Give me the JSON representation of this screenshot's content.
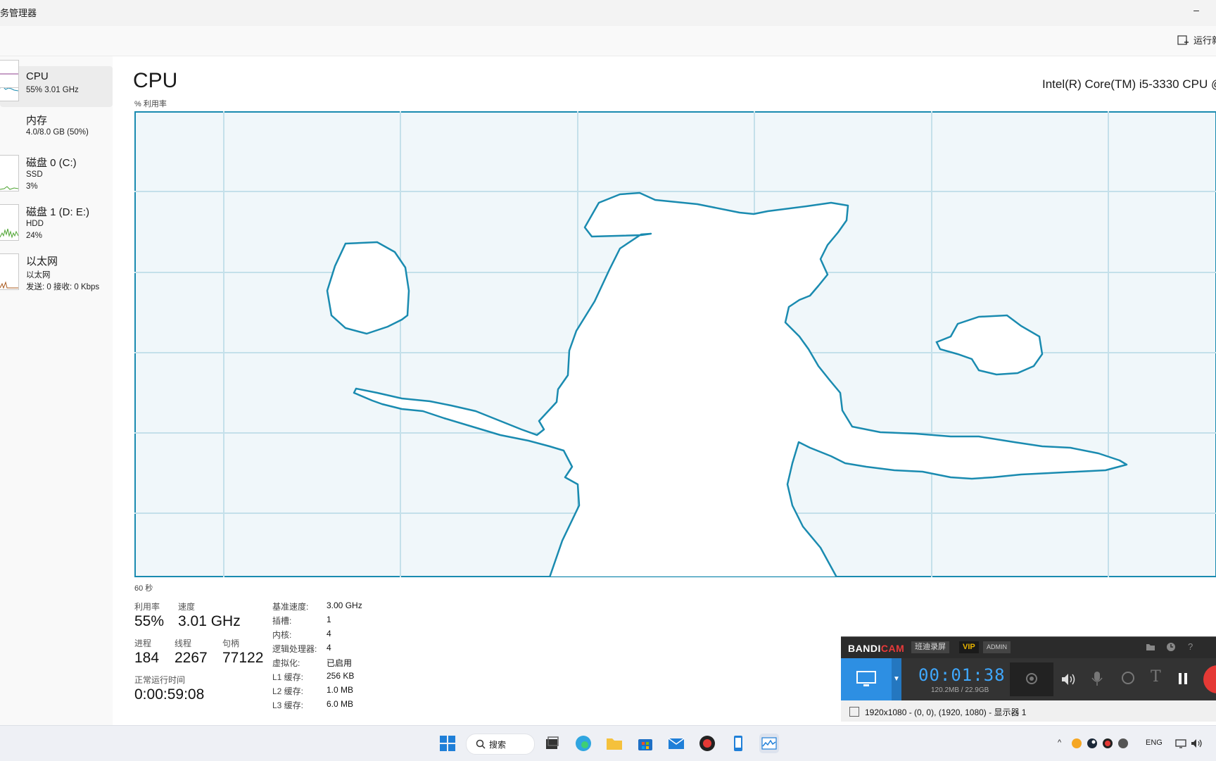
{
  "window": {
    "title": "务管理器",
    "minimize": "–"
  },
  "toolbar": {
    "run_task": "运行新"
  },
  "sidebar": {
    "items": [
      {
        "name": "CPU",
        "line1": "55% 3.01 GHz",
        "line2": ""
      },
      {
        "name": "内存",
        "line1": "4.0/8.0 GB (50%)",
        "line2": ""
      },
      {
        "name": "磁盘 0 (C:)",
        "line1": "SSD",
        "line2": "3%"
      },
      {
        "name": "磁盘 1 (D: E:)",
        "line1": "HDD",
        "line2": "24%"
      },
      {
        "name": "以太网",
        "line1": "以太网",
        "line2": "发送: 0 接收: 0 Kbps"
      }
    ]
  },
  "cpu": {
    "title": "CPU",
    "model": "Intel(R) Core(TM) i5-3330 CPU @",
    "util_label": "% 利用率",
    "time_label": "60 秒",
    "stats": {
      "utilization_label": "利用率",
      "utilization": "55%",
      "speed_label": "速度",
      "speed": "3.01 GHz",
      "processes_label": "进程",
      "processes": "184",
      "threads_label": "线程",
      "threads": "2267",
      "handles_label": "句柄",
      "handles": "77122",
      "uptime_label": "正常运行时间",
      "uptime": "0:00:59:08"
    },
    "details": [
      {
        "key": "基准速度:",
        "value": "3.00 GHz"
      },
      {
        "key": "插槽:",
        "value": "1"
      },
      {
        "key": "内核:",
        "value": "4"
      },
      {
        "key": "逻辑处理器:",
        "value": "4"
      },
      {
        "key": "虚拟化:",
        "value": "已启用"
      },
      {
        "key": "L1 缓存:",
        "value": "256 KB"
      },
      {
        "key": "L2 缓存:",
        "value": "1.0 MB"
      },
      {
        "key": "L3 缓存:",
        "value": "6.0 MB"
      }
    ],
    "graph_color": "#1a8bb0",
    "graph_fill": "#f0f7fa"
  },
  "bandicam": {
    "brand_a": "BANDI",
    "brand_b": "CAM",
    "label": "班迪录屏",
    "vip": "VIP",
    "admin": "ADMIN",
    "time": "00:01:38",
    "size": "120.2MB / 22.9GB",
    "resolution": "1920x1080 - (0, 0), (1920, 1080) - 显示器 1"
  },
  "taskbar": {
    "search": "搜索",
    "lang": "ENG"
  }
}
